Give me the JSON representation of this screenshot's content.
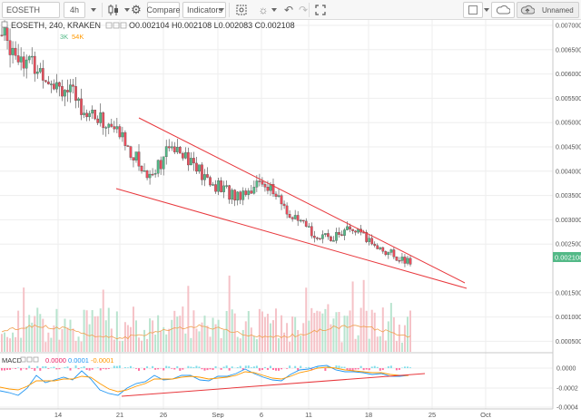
{
  "toolbar": {
    "symbol": "EOSETH",
    "interval": "4h",
    "compare_label": "Compare",
    "indicators_label": "Indicators",
    "layout_name": "Unnamed"
  },
  "legend": {
    "title": "EOSETH, 240, KRAKEN",
    "ohlc": "O0.002104 H0.002108 L0.002083 C0.002108",
    "vol_a": "3K",
    "vol_b": "54K"
  },
  "macd": {
    "label": "MACD",
    "v1": "0.0000",
    "v2": "0.0001",
    "v3": "-0.0001"
  },
  "price_axis": {
    "labels": [
      "0.007000",
      "0.006500",
      "0.006000",
      "0.005500",
      "0.005000",
      "0.004500",
      "0.004000",
      "0.003500",
      "0.003000",
      "0.002500",
      "0.001500",
      "0.001000",
      "0.000500"
    ],
    "last_price": "0.002108"
  },
  "macd_axis": {
    "labels": [
      "0.0000",
      "-0.0002",
      "-0.0004"
    ]
  },
  "time_axis": {
    "labels": [
      "14",
      "21",
      "26",
      "Sep",
      "6",
      "11",
      "18",
      "25",
      "Oct"
    ]
  },
  "colors": {
    "up": "#53b987",
    "down": "#eb4d5c",
    "trendline": "#e8383d",
    "last_price_bg": "#53b987",
    "macd_line": "#2196f3",
    "signal_line": "#ff9800"
  },
  "chart_data": {
    "type": "candlestick",
    "symbol": "EOSETH",
    "exchange": "KRAKEN",
    "interval_minutes": 240,
    "last": {
      "open": 0.002104,
      "high": 0.002108,
      "low": 0.002083,
      "close": 0.002108
    },
    "ylim": [
      0.00125,
      0.00715
    ],
    "approx_close_path": [
      {
        "x": "Aug 9",
        "y": 0.0068
      },
      {
        "x": "Aug 11",
        "y": 0.0062
      },
      {
        "x": "Aug 14",
        "y": 0.0058
      },
      {
        "x": "Aug 16",
        "y": 0.0052
      },
      {
        "x": "Aug 19",
        "y": 0.0048
      },
      {
        "x": "Aug 21",
        "y": 0.0039
      },
      {
        "x": "Aug 23",
        "y": 0.0046
      },
      {
        "x": "Aug 26",
        "y": 0.0038
      },
      {
        "x": "Aug 29",
        "y": 0.0035
      },
      {
        "x": "Sep 2",
        "y": 0.0038
      },
      {
        "x": "Sep 5",
        "y": 0.003
      },
      {
        "x": "Sep 9",
        "y": 0.0026
      },
      {
        "x": "Sep 13",
        "y": 0.0028
      },
      {
        "x": "Sep 17",
        "y": 0.0024
      },
      {
        "x": "Sep 21",
        "y": 0.0021
      }
    ]
  }
}
